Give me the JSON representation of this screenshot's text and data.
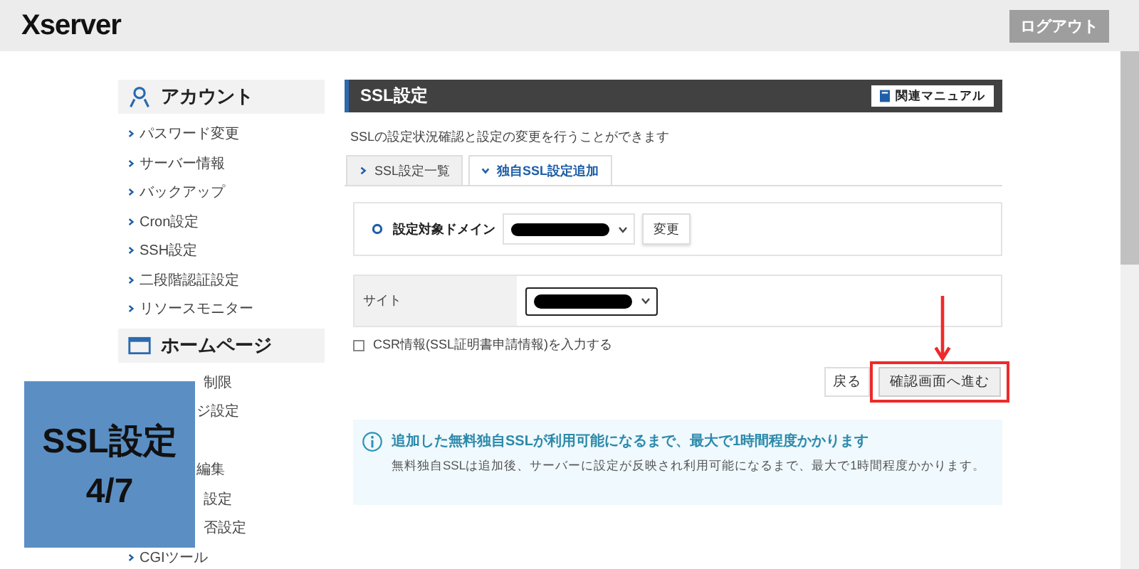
{
  "header": {
    "logo": "Xserver",
    "logout": "ログアウト"
  },
  "sidebar": {
    "sections": [
      {
        "title": "アカウント",
        "kind": "account",
        "items": [
          "パスワード変更",
          "サーバー情報",
          "バックアップ",
          "Cron設定",
          "SSH設定",
          "二段階認証設定",
          "リソースモニター"
        ]
      },
      {
        "title": "ホームページ",
        "kind": "homepage",
        "items": [
          {
            "label": "制限",
            "kind": "covered"
          },
          {
            "label": "ジ設定",
            "kind": "covered"
          },
          {
            "label": "編集",
            "kind": "covered"
          },
          {
            "label": "設定",
            "kind": "covered"
          },
          {
            "label": "否設定",
            "kind": "covered"
          },
          {
            "label": "CGIツール",
            "kind": "link"
          }
        ]
      }
    ]
  },
  "main": {
    "title": "SSL設定",
    "manual_button": "関連マニュアル",
    "description": "SSLの設定状況確認と設定の変更を行うことができます",
    "tabs": [
      {
        "label": "SSL設定一覧",
        "selected": false
      },
      {
        "label": "独自SSL設定追加",
        "selected": true
      }
    ],
    "domain": {
      "label": "設定対象ドメイン",
      "change_button": "変更"
    },
    "site": {
      "label": "サイト"
    },
    "csr": {
      "label": "CSR情報(SSL証明書申請情報)を入力する",
      "checked": false
    },
    "buttons": {
      "back": "戻る",
      "confirm": "確認画面へ進む"
    },
    "notice": {
      "title": "追加した無料独自SSLが利用可能になるまで、最大で1時間程度かかります",
      "body": "無料独自SSLは追加後、サーバーに設定が反映され利用可能になるまで、最大で1時間程度かかります。"
    }
  },
  "step_badge": {
    "title": "SSL設定",
    "step": "4/7"
  }
}
